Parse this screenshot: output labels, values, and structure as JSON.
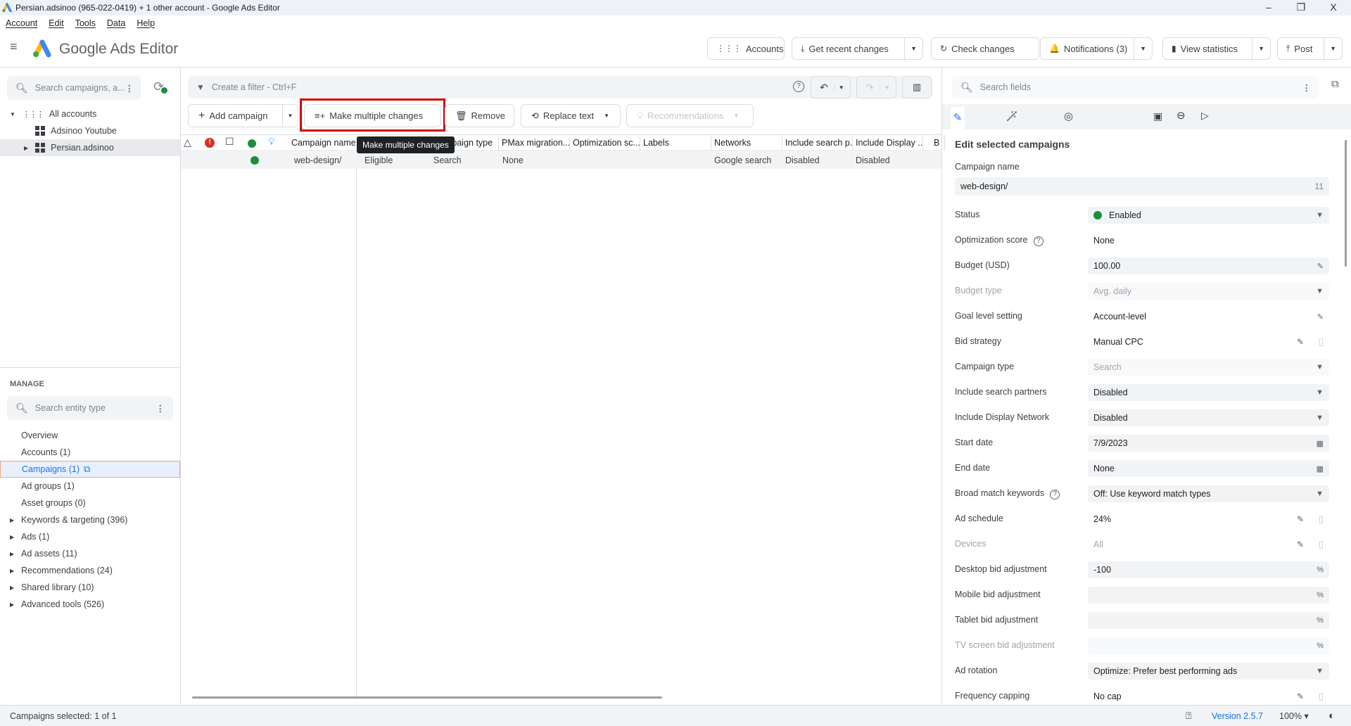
{
  "window": {
    "title": "Persian.adsinoo (965-022-0419) + 1 other account - Google Ads Editor",
    "minimize": "–",
    "maximize": "❐",
    "close": "X"
  },
  "menu": [
    "Account",
    "Edit",
    "Tools",
    "Data",
    "Help"
  ],
  "header": {
    "app_name": "Google Ads Editor",
    "buttons": [
      {
        "label": "Accounts",
        "icon": "apps-grid-icon",
        "glyph": "⋮⋮⋮",
        "dropdown": false
      },
      {
        "label": "Get recent changes",
        "icon": "download-icon",
        "glyph": "⤓",
        "dropdown": true
      },
      {
        "label": "Check changes",
        "icon": "refresh-icon",
        "glyph": "↻",
        "dropdown": false
      },
      {
        "label": "Notifications (3)",
        "icon": "bell-icon",
        "glyph": "🔔",
        "dropdown": true
      },
      {
        "label": "View statistics",
        "icon": "bar-chart-icon",
        "glyph": "▮",
        "dropdown": true
      },
      {
        "label": "Post",
        "icon": "upload-icon",
        "glyph": "⤒",
        "dropdown": true
      }
    ]
  },
  "left": {
    "search_placeholder": "Search campaigns, a...",
    "tree": [
      {
        "label": "All accounts"
      },
      {
        "label": "Adsinoo Youtube"
      },
      {
        "label": "Persian.adsinoo"
      }
    ],
    "manage_title": "MANAGE",
    "entity_search_placeholder": "Search entity type",
    "manage_items": [
      {
        "label": "Overview",
        "expandable": false
      },
      {
        "label": "Accounts (1)",
        "expandable": false
      },
      {
        "label": "Campaigns (1)",
        "expandable": false,
        "selected": true
      },
      {
        "label": "Ad groups (1)",
        "expandable": false
      },
      {
        "label": "Asset groups (0)",
        "expandable": false
      },
      {
        "label": "Keywords & targeting (396)",
        "expandable": true
      },
      {
        "label": "Ads (1)",
        "expandable": true
      },
      {
        "label": "Ad assets (11)",
        "expandable": true
      },
      {
        "label": "Recommendations (24)",
        "expandable": true
      },
      {
        "label": "Shared library (10)",
        "expandable": true
      },
      {
        "label": "Advanced tools (526)",
        "expandable": true
      }
    ]
  },
  "center": {
    "filter_placeholder": "Create a filter - Ctrl+F",
    "toolbar": {
      "add_campaign": "Add campaign",
      "make_multiple_changes": "Make multiple changes",
      "remove": "Remove",
      "replace_text": "Replace text",
      "recommendations": "Recommendations"
    },
    "tooltip": "Make multiple changes",
    "columns": [
      "Campaign name",
      "Status",
      "Campaign type",
      "PMax migration...",
      "Optimization sc...",
      "Labels",
      "Networks",
      "Include search p...",
      "Include Display ...",
      "B"
    ],
    "rows": [
      {
        "status_color": "#1e8e3e",
        "cells": [
          "web-design/",
          "Eligible",
          "Search",
          "None",
          "",
          "",
          "Google search",
          "Disabled",
          "Disabled"
        ]
      }
    ]
  },
  "right": {
    "search_placeholder": "Search fields",
    "title": "Edit selected campaigns",
    "campaign_name_label": "Campaign name",
    "campaign_name_value": "web-design/",
    "campaign_name_count": "11",
    "fields": [
      {
        "label": "Status",
        "value": "Enabled",
        "kind": "select",
        "dot": "#1e8e3e"
      },
      {
        "label": "Optimization score",
        "value": "None",
        "kind": "text",
        "help": true
      },
      {
        "label": "Budget (USD)",
        "value": "100.00",
        "kind": "edit-box"
      },
      {
        "label": "Budget type",
        "value": "Avg. daily",
        "kind": "select",
        "disabled": true
      },
      {
        "label": "Goal level setting",
        "value": "Account-level",
        "kind": "edit"
      },
      {
        "label": "Bid strategy",
        "value": "Manual CPC",
        "kind": "edit-copy"
      },
      {
        "label": "Campaign type",
        "value": "Search",
        "kind": "select",
        "disabled": true,
        "labelEnabled": true
      },
      {
        "label": "Include search partners",
        "value": "Disabled",
        "kind": "select"
      },
      {
        "label": "Include Display Network",
        "value": "Disabled",
        "kind": "select"
      },
      {
        "label": "Start date",
        "value": "7/9/2023",
        "kind": "date"
      },
      {
        "label": "End date",
        "value": "None",
        "kind": "date"
      },
      {
        "label": "Broad match keywords",
        "value": "Off: Use keyword match types",
        "kind": "select",
        "help": true
      },
      {
        "label": "Ad schedule",
        "value": "24%",
        "kind": "edit-copy"
      },
      {
        "label": "Devices",
        "value": "All",
        "kind": "edit-copy",
        "disabled": true
      },
      {
        "label": "Desktop bid adjustment",
        "value": "-100",
        "kind": "percent"
      },
      {
        "label": "Mobile bid adjustment",
        "value": "",
        "kind": "percent"
      },
      {
        "label": "Tablet bid adjustment",
        "value": "",
        "kind": "percent"
      },
      {
        "label": "TV screen bid adjustment",
        "value": "",
        "kind": "percent",
        "disabled": true
      },
      {
        "label": "Ad rotation",
        "value": "Optimize: Prefer best performing ads",
        "kind": "select"
      },
      {
        "label": "Frequency capping",
        "value": "No cap",
        "kind": "edit-copy"
      }
    ]
  },
  "statusbar": {
    "selection": "Campaigns selected: 1 of 1",
    "version": "Version 2.5.7",
    "zoom": "100%"
  },
  "colors": {
    "accent": "#1a73e8",
    "highlight_box": "#d50000",
    "enabled": "#1e8e3e",
    "error": "#d93025"
  }
}
